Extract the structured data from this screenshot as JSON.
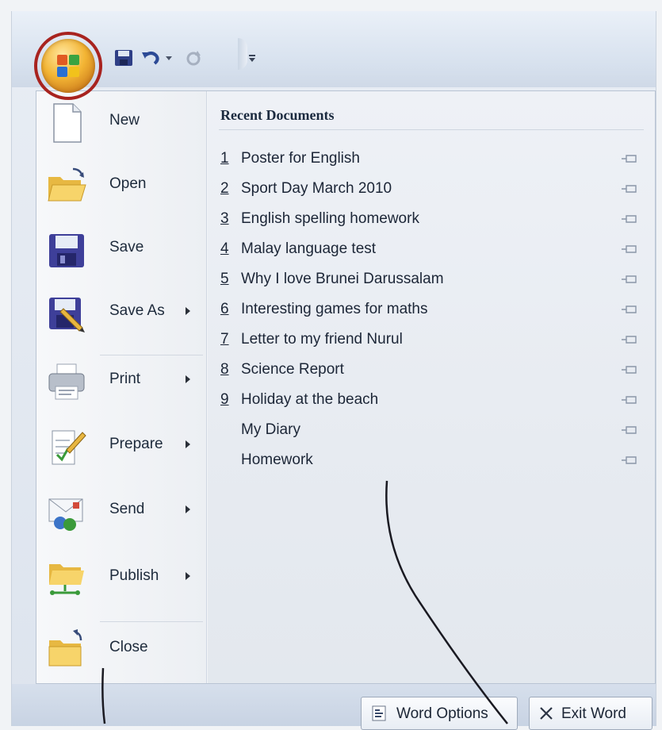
{
  "quick_access": {
    "icons": [
      "office-button-icon",
      "save-icon",
      "undo-icon",
      "undo-dropdown-icon",
      "redo-icon",
      "customize-dropdown-icon"
    ]
  },
  "menu": {
    "commands": [
      {
        "label": "New",
        "icon": "new-document-icon",
        "submenu": false
      },
      {
        "label": "Open",
        "icon": "open-folder-icon",
        "submenu": false
      },
      {
        "label": "Save",
        "icon": "save-disk-icon",
        "submenu": false
      },
      {
        "label": "Save As",
        "icon": "save-as-icon",
        "submenu": true
      },
      {
        "label": "Print",
        "icon": "printer-icon",
        "submenu": true
      },
      {
        "label": "Prepare",
        "icon": "prepare-icon",
        "submenu": true
      },
      {
        "label": "Send",
        "icon": "send-icon",
        "submenu": true
      },
      {
        "label": "Publish",
        "icon": "publish-icon",
        "submenu": true
      },
      {
        "label": "Close",
        "icon": "close-folder-icon",
        "submenu": false
      }
    ]
  },
  "recent": {
    "header": "Recent Documents",
    "documents": [
      {
        "num": "1",
        "name": "Poster for English"
      },
      {
        "num": "2",
        "name": "Sport Day March 2010"
      },
      {
        "num": "3",
        "name": "English spelling homework"
      },
      {
        "num": "4",
        "name": "Malay language test"
      },
      {
        "num": "5",
        "name": "Why I love Brunei Darussalam"
      },
      {
        "num": "6",
        "name": "Interesting games for maths"
      },
      {
        "num": "7",
        "name": "Letter to my friend Nurul"
      },
      {
        "num": "8",
        "name": "Science Report"
      },
      {
        "num": "9",
        "name": "Holiday at the beach"
      },
      {
        "num": "",
        "name": "My Diary"
      },
      {
        "num": "",
        "name": "Homework"
      }
    ]
  },
  "footer": {
    "word_options": "Word Options",
    "exit_word": "Exit Word"
  },
  "colors": {
    "office_ring": "#a8231f",
    "office_button": "#f3b534",
    "text": "#1c2637"
  }
}
